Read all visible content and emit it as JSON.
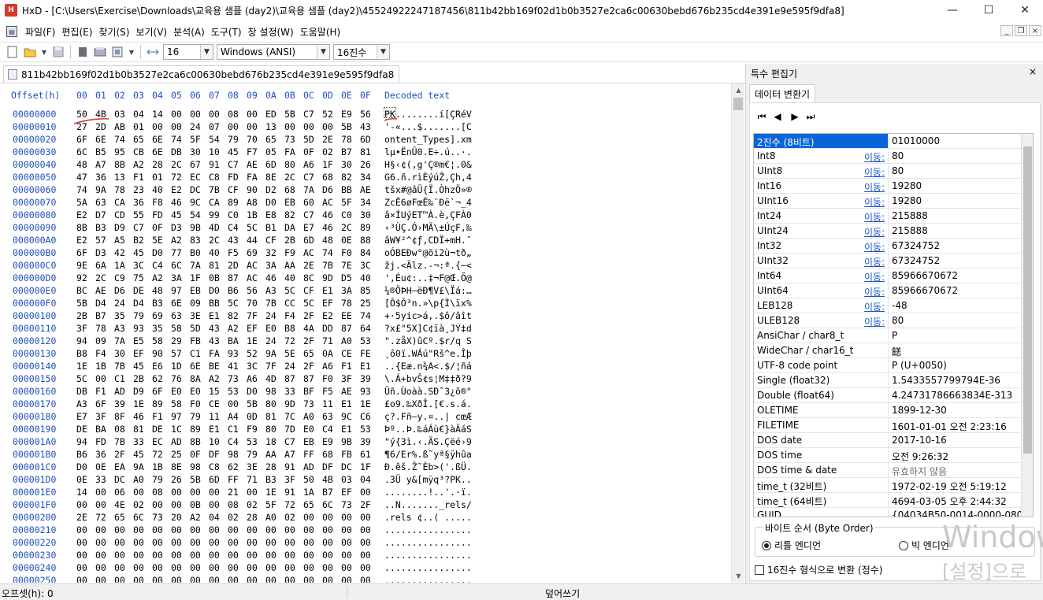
{
  "window": {
    "title": "HxD - [C:\\Users\\Exercise\\Downloads\\교육용 샘플 (day2)\\교육용 샘플 (day2)\\4552492224718745​6\\811b42bb169f02d1b0b3527e2ca6c00630bebd676b235cd4e391e9e595f9dfa8]",
    "app_icon_text": "HxD"
  },
  "menu": [
    "파일(F)",
    "편집(E)",
    "찾기(S)",
    "보기(V)",
    "분석(A)",
    "도구(T)",
    "창 설정(W)",
    "도움말(H)"
  ],
  "toolbar": {
    "bytes_per_row": "16",
    "charset": "Windows (ANSI)",
    "offset_base": "16진수"
  },
  "tab": {
    "label": "811b42bb169f02d1b0b3527e2ca6c00630bebd676b235cd4e391e9e595f9dfa8"
  },
  "hex": {
    "header_offset": "Offset(h)",
    "header_cols": [
      "00",
      "01",
      "02",
      "03",
      "04",
      "05",
      "06",
      "07",
      "08",
      "09",
      "0A",
      "0B",
      "0C",
      "0D",
      "0E",
      "0F"
    ],
    "header_text": "Decoded text",
    "rows": [
      {
        "o": "00000000",
        "b": "50 4B 03 04 14 00 00 00 08 00 ED 5B C7 52 E9 56",
        "t": "PK........í[ÇRéV"
      },
      {
        "o": "00000010",
        "b": "27 2D AB 01 00 00 24 07 00 00 13 00 00 00 5B 43",
        "t": "'-«...$.......[C"
      },
      {
        "o": "00000020",
        "b": "6F 6E 74 65 6E 74 5F 54 79 70 65 73 5D 2E 78 6D",
        "t": "ontent_Types].xm"
      },
      {
        "o": "00000030",
        "b": "6C B5 95 CB 6E DB 30 10 45 F7 05 FA 0F 02 B7 81",
        "t": "lµ•ËnÛ0.E÷.ú..·."
      },
      {
        "o": "00000040",
        "b": "48 A7 8B A2 28 2C 67 91 C7 AE 6D 80 A6 1F 30 26",
        "t": "H§‹¢(,g'Ç®m€¦.0&"
      },
      {
        "o": "00000050",
        "b": "47 36 13 F1 01 72 EC C8 FD FA 8E 2C C7 68 82 34",
        "t": "G6.ñ.rìÈýúŽ,Çh‚4"
      },
      {
        "o": "00000060",
        "b": "74 9A 78 23 40 E2 DC 7B CF 90 D2 68 7A D6 BB AE",
        "t": "tšx#@âÜ{Ï.ÒhzÖ»®"
      },
      {
        "o": "00000070",
        "b": "5A 63 CA 36 F8 46 9C CA 89 A8 D0 EB 60 AC 5F 34",
        "t": "ZcÊ6øFœÊ‰¨Ðë`¬_4"
      },
      {
        "o": "00000080",
        "b": "E2 D7 CD 55 FD 45 54 99 C0 1B E8 82 C7 46 C0 30",
        "t": "â×ÍUýET™À.è‚ÇFÀ0"
      },
      {
        "o": "00000090",
        "b": "8B B3 D9 C7 0F D3 9B 4D C4 5C B1 DA E7 46 2C 89",
        "t": "‹³ÙÇ.Ó›MÄ\\±ÚçF,‰"
      },
      {
        "o": "000000A0",
        "b": "E2 57 A5 B2 5E A2 83 2C 43 44 CF 2B 6D 48 0E 88",
        "t": "âW¥²^¢ƒ,CDÏ+mH.ˆ"
      },
      {
        "o": "000000B0",
        "b": "6F D3 42 45 D0 77 B0 40 F5 69 32 F9 AC 74 F0 84",
        "t": "oÓBEÐw°@õi2ù¬tð„"
      },
      {
        "o": "000000C0",
        "b": "9E 6A 1A 3C C4 6C 7A 81 2D AC 3A AA 2E 7B 7E 3C",
        "t": "žj.<Älz.-¬:ª.{~<"
      },
      {
        "o": "000000D0",
        "b": "92 2C C9 75 A2 3A 1F 0B 87 AC 46 40 8C 9D D5 40",
        "t": "',Éu¢:..‡¬F@Œ.Õ@"
      },
      {
        "o": "000000E0",
        "b": "BC AE D6 DE 48 97 EB D0 B6 56 A3 5C CF E1 3A 85",
        "t": "¼®ÖÞH—ëÐ¶V£\\Ïá:…"
      },
      {
        "o": "000000F0",
        "b": "5B D4 24 D4 B3 6E 09 BB 5C 70 7B CC 5C EF 78 25",
        "t": "[Ô$Ô³n.»\\p{Ì\\ïx%"
      },
      {
        "o": "00000100",
        "b": "2B B7 35 79 69 63 3E E1 82 7F 24 F4 2F E2 EE 74",
        "t": "+·5yic>á‚.$ô/âît"
      },
      {
        "o": "00000110",
        "b": "3F 78 A3 93 35 58 5D 43 A2 EF E0 B8 4A DD 87 64",
        "t": "?x£\"5X]C¢ïà¸JÝ‡d"
      },
      {
        "o": "00000120",
        "b": "94 09 7A E5 58 29 FB 43 BA 1E 24 72 2F 71 A0 53",
        "t": "\".zåX)ûCº.$r/q S"
      },
      {
        "o": "00000130",
        "b": "B8 F4 30 EF 90 57 C1 FA 93 52 9A 5E 65 0A CE FE",
        "t": "¸ô0ï.WÁú\"Rš^e.Îþ"
      },
      {
        "o": "00000140",
        "b": "1E 1B 7B 45 E6 1D 6E BE 41 3C 7F 24 2F A6 F1 E1",
        "t": "..{Eæ.n¾A<.$/¦ñá"
      },
      {
        "o": "00000150",
        "b": "5C 00 C1 2B 62 76 8A A2 73 A6 4D 87 87 F0 3F 39",
        "t": "\\.Á+bvŠ¢s¦M‡‡ð?9"
      },
      {
        "o": "00000160",
        "b": "DB F1 AD D9 6F E0 E0 15 53 D0 98 33 BF F5 AE 93",
        "t": "Ûñ.Ùoàà.SÐ˜3¿õ®\""
      },
      {
        "o": "00000170",
        "b": "A3 6F 39 1E 89 58 F0 CE 00 5B 80 9D 73 11 E1 1E",
        "t": "£o9.‰XðÎ.[€.s.á."
      },
      {
        "o": "00000180",
        "b": "E7 3F 8F 46 F1 97 79 11 A4 0D 81 7C A0 63 9C C6",
        "t": "ç?.Fñ—y.¤..| cœÆ"
      },
      {
        "o": "00000190",
        "b": "DE BA 08 81 DE 1C 89 E1 C1 F9 80 7D E0 C4 E1 53",
        "t": "Þº..Þ.‰áÁù€}àÄáS"
      },
      {
        "o": "000001A0",
        "b": "94 FD 7B 33 EC AD 8B 10 C4 53 18 C7 EB E9 9B 39",
        "t": "\"ý{3ì.‹.ÄS.Çëé›9"
      },
      {
        "o": "000001B0",
        "b": "B6 36 2F 45 72 25 0F DF 98 79 AA A7 FF 68 FB 61",
        "t": "¶6/Er%.ß˜yª§ÿhûa"
      },
      {
        "o": "000001C0",
        "b": "D0 0E EA 9A 1B 8E 98 C8 62 3E 28 91 AD DF DC 1F",
        "t": "Ð.êš.Ž˜Èb>('.ßÜ."
      },
      {
        "o": "000001D0",
        "b": "0E 33 DC A0 79 26 5B 6D FF 71 B3 3F 50 4B 03 04",
        "t": ".3Ü y&[mÿq³?PK.."
      },
      {
        "o": "000001E0",
        "b": "14 00 06 00 08 00 00 00 21 00 1E 91 1A B7 EF 00",
        "t": "........!..'.·ï."
      },
      {
        "o": "000001F0",
        "b": "00 00 4E 02 00 00 0B 00 08 02 5F 72 65 6C 73 2F",
        "t": "..N......._rels/"
      },
      {
        "o": "00000200",
        "b": "2E 72 65 6C 73 20 A2 04 02 28 A0 02 00 00 00 00",
        "t": ".rels ¢..( ....."
      },
      {
        "o": "00000210",
        "b": "00 00 00 00 00 00 00 00 00 00 00 00 00 00 00 00",
        "t": "................"
      },
      {
        "o": "00000220",
        "b": "00 00 00 00 00 00 00 00 00 00 00 00 00 00 00 00",
        "t": "................"
      },
      {
        "o": "00000230",
        "b": "00 00 00 00 00 00 00 00 00 00 00 00 00 00 00 00",
        "t": "................"
      },
      {
        "o": "00000240",
        "b": "00 00 00 00 00 00 00 00 00 00 00 00 00 00 00 00",
        "t": "................"
      },
      {
        "o": "00000250",
        "b": "00 00 00 00 00 00 00 00 00 00 00 00 00 00 00 00",
        "t": "................"
      }
    ]
  },
  "status": {
    "offset": "오프셋(h): 0",
    "mode": "덮어쓰기"
  },
  "panel": {
    "title": "특수 편집기",
    "close": "×",
    "tab": "데이터 변환기",
    "link_label": "이동:",
    "rows": [
      {
        "name": "2진수 (8비트)",
        "link": false,
        "value": "01010000",
        "selected": true
      },
      {
        "name": "Int8",
        "link": true,
        "value": "80"
      },
      {
        "name": "UInt8",
        "link": true,
        "value": "80"
      },
      {
        "name": "Int16",
        "link": true,
        "value": "19280"
      },
      {
        "name": "UInt16",
        "link": true,
        "value": "19280"
      },
      {
        "name": "Int24",
        "link": true,
        "value": "215888"
      },
      {
        "name": "UInt24",
        "link": true,
        "value": "215888"
      },
      {
        "name": "Int32",
        "link": true,
        "value": "67324752"
      },
      {
        "name": "UInt32",
        "link": true,
        "value": "67324752"
      },
      {
        "name": "Int64",
        "link": true,
        "value": "85966670672"
      },
      {
        "name": "UInt64",
        "link": true,
        "value": "85966670672"
      },
      {
        "name": "LEB128",
        "link": true,
        "value": "-48"
      },
      {
        "name": "ULEB128",
        "link": true,
        "value": "80"
      },
      {
        "name": "AnsiChar / char8_t",
        "link": false,
        "value": "P"
      },
      {
        "name": "WideChar / char16_t",
        "link": false,
        "value": "䭐"
      },
      {
        "name": "UTF-8 code point",
        "link": false,
        "value": "P (U+0050)"
      },
      {
        "name": "Single (float32)",
        "link": false,
        "value": "1.5433557799794E-36"
      },
      {
        "name": "Double (float64)",
        "link": false,
        "value": "4.24731786663834E-313"
      },
      {
        "name": "OLETIME",
        "link": false,
        "value": "1899-12-30"
      },
      {
        "name": "FILETIME",
        "link": false,
        "value": "1601-01-01 오전 2:23:16"
      },
      {
        "name": "DOS date",
        "link": false,
        "value": "2017-10-16"
      },
      {
        "name": "DOS time",
        "link": false,
        "value": "오전 9:26:32"
      },
      {
        "name": "DOS time & date",
        "link": false,
        "value": "유효하지 않음",
        "muted": true
      },
      {
        "name": "time_t (32비트)",
        "link": false,
        "value": "1972-02-19 오전 5:19:12"
      },
      {
        "name": "time_t (64비트)",
        "link": false,
        "value": "4694-03-05 오후 2:44:32"
      },
      {
        "name": "GUID",
        "link": false,
        "value": "{04034B50-0014-0000-0800-"
      }
    ],
    "byte_order_label": "바이트 순서 (Byte Order)",
    "little_endian": "리틀 엔디언",
    "big_endian": "빅 엔디언",
    "hex_convert": "16진수 형식으로 변환 (정수)"
  },
  "watermark": {
    "line1": "Window",
    "line2": "[설정]으로"
  },
  "colors": {
    "offset_blue": "#1f4fbf",
    "selection_blue": "#0a64d8",
    "link_blue": "#1a56c8",
    "annotation_red": "#d9362b"
  }
}
